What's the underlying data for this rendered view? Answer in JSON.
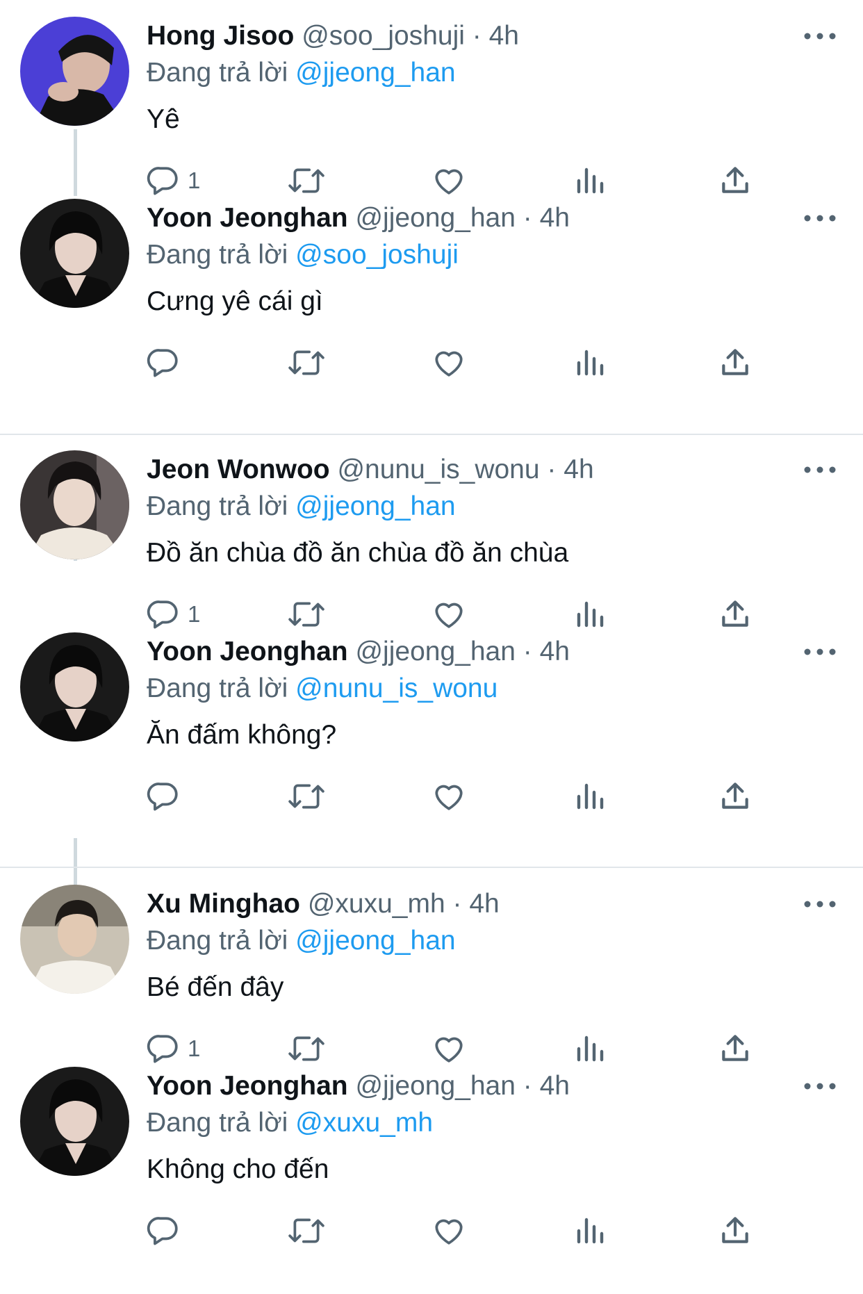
{
  "tweets": [
    {
      "name": "Hong Jisoo",
      "handle": "@soo_joshuji",
      "dot": "·",
      "time": "4h",
      "reply_prefix": "Đang trả lời",
      "reply_to": "@jjeong_han",
      "text": "Yê",
      "reply_count": "1",
      "avatar_color": "#4b3fd6"
    },
    {
      "name": "Yoon Jeonghan",
      "handle": "@jjeong_han",
      "dot": "·",
      "time": "4h",
      "reply_prefix": "Đang trả lời",
      "reply_to": "@soo_joshuji",
      "text": "Cưng yê cái gì",
      "reply_count": "",
      "avatar_color": "#1a1a1a"
    },
    {
      "name": "Jeon Wonwoo",
      "handle": "@nunu_is_wonu",
      "dot": "·",
      "time": "4h",
      "reply_prefix": "Đang trả lời",
      "reply_to": "@jjeong_han",
      "text": "Đồ ăn chùa đồ ăn chùa đồ ăn chùa",
      "reply_count": "1",
      "avatar_color": "#3a3535"
    },
    {
      "name": "Yoon Jeonghan",
      "handle": "@jjeong_han",
      "dot": "·",
      "time": "4h",
      "reply_prefix": "Đang trả lời",
      "reply_to": "@nunu_is_wonu",
      "text": "Ăn đấm không?",
      "reply_count": "",
      "avatar_color": "#1a1a1a"
    },
    {
      "name": "Xu Minghao",
      "handle": "@xuxu_mh",
      "dot": "·",
      "time": "4h",
      "reply_prefix": "Đang trả lời",
      "reply_to": "@jjeong_han",
      "text": "Bé đến đây",
      "reply_count": "1",
      "avatar_color": "#c9c2b4"
    },
    {
      "name": "Yoon Jeonghan",
      "handle": "@jjeong_han",
      "dot": "·",
      "time": "4h",
      "reply_prefix": "Đang trả lời",
      "reply_to": "@xuxu_mh",
      "text": "Không cho đến",
      "reply_count": "",
      "avatar_color": "#1a1a1a"
    }
  ],
  "colors": {
    "accent": "#1d9bf0",
    "secondary_text": "#536471",
    "thread_line": "#cfd9de",
    "divider": "#e1e6ea"
  },
  "icons": {
    "reply": "speech-bubble-icon",
    "retweet": "retweet-icon",
    "like": "heart-icon",
    "views": "bar-chart-icon",
    "share": "share-upload-icon",
    "more": "more-dots-icon"
  }
}
